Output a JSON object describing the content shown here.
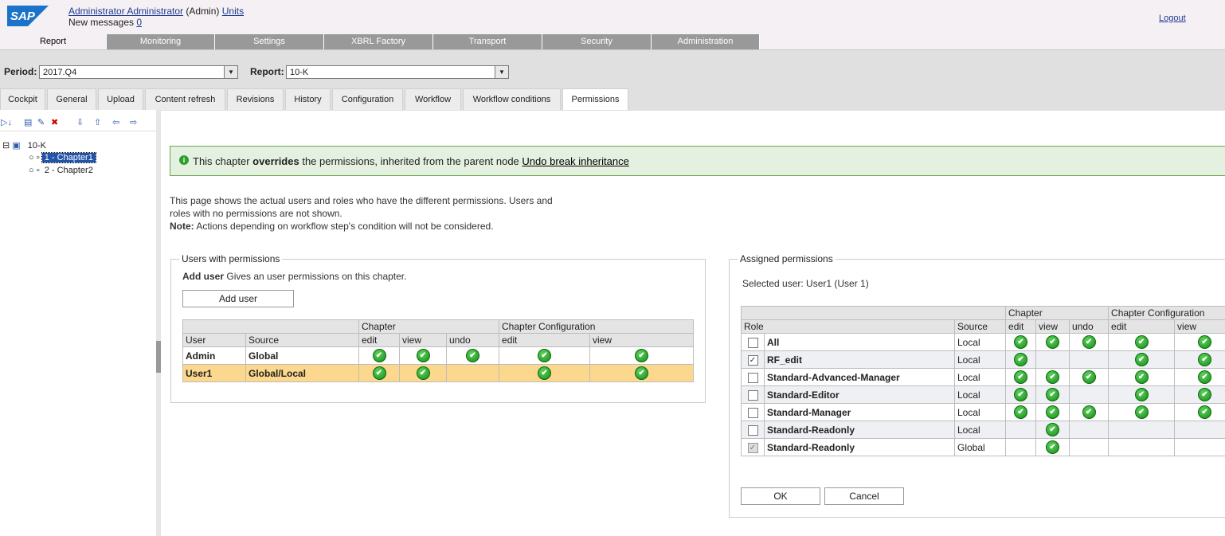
{
  "header": {
    "logo_text": "SAP",
    "user_name": "Administrator Administrator",
    "user_role": "(Admin)",
    "units_link": "Units",
    "new_messages_label": "New messages",
    "new_messages_count": "0",
    "logout": "Logout"
  },
  "main_nav": [
    "Report",
    "Monitoring",
    "Settings",
    "XBRL Factory",
    "Transport",
    "Security",
    "Administration"
  ],
  "filters": {
    "period_label": "Period:",
    "period_value": "2017.Q4",
    "report_label": "Report:",
    "report_value": "10-K"
  },
  "sub_tabs": [
    "Cockpit",
    "General",
    "Upload",
    "Content refresh",
    "Revisions",
    "History",
    "Configuration",
    "Workflow",
    "Workflow conditions",
    "Permissions"
  ],
  "tree": {
    "root": "10-K",
    "children": [
      "1 - Chapter1",
      "2 - Chapter2"
    ]
  },
  "info": {
    "pre": "This chapter",
    "bold": "overrides",
    "post": "the permissions, inherited from the parent node",
    "link": "Undo break inheritance"
  },
  "description": {
    "line1": "This page shows the actual users and roles who have the different permissions. Users and",
    "line2": "roles with no permissions are not shown.",
    "note_label": "Note:",
    "note_text": "Actions depending on workflow step's condition will not be considered."
  },
  "users_panel": {
    "legend": "Users with permissions",
    "add_user_bold": "Add user",
    "add_user_desc": "Gives an user permissions on this chapter.",
    "add_user_button": "Add user",
    "group_chapter": "Chapter",
    "group_chapter_config": "Chapter Configuration",
    "columns": [
      "User",
      "Source",
      "edit",
      "view",
      "undo",
      "edit",
      "view"
    ],
    "rows": [
      {
        "user": "Admin",
        "source": "Global",
        "perms": [
          true,
          true,
          true,
          true,
          true
        ]
      },
      {
        "user": "User1",
        "source": "Global/Local",
        "perms": [
          true,
          true,
          false,
          true,
          true
        ]
      }
    ]
  },
  "assigned_panel": {
    "legend": "Assigned permissions",
    "selected_user": "Selected user: User1 (User 1)",
    "group_chapter": "Chapter",
    "group_chapter_config": "Chapter Configuration",
    "columns": [
      "Role",
      "Source",
      "edit",
      "view",
      "undo",
      "edit",
      "view"
    ],
    "rows": [
      {
        "role": "All",
        "source": "Local",
        "checked": false,
        "disabled": false,
        "perms": [
          true,
          true,
          true,
          true,
          true
        ]
      },
      {
        "role": "RF_edit",
        "source": "Local",
        "checked": true,
        "disabled": false,
        "perms": [
          true,
          false,
          false,
          true,
          true
        ]
      },
      {
        "role": "Standard-Advanced-Manager",
        "source": "Local",
        "checked": false,
        "disabled": false,
        "perms": [
          true,
          true,
          true,
          true,
          true
        ]
      },
      {
        "role": "Standard-Editor",
        "source": "Local",
        "checked": false,
        "disabled": false,
        "perms": [
          true,
          true,
          false,
          true,
          true
        ]
      },
      {
        "role": "Standard-Manager",
        "source": "Local",
        "checked": false,
        "disabled": false,
        "perms": [
          true,
          true,
          true,
          true,
          true
        ]
      },
      {
        "role": "Standard-Readonly",
        "source": "Local",
        "checked": false,
        "disabled": false,
        "perms": [
          false,
          true,
          false,
          false,
          false
        ]
      },
      {
        "role": "Standard-Readonly",
        "source": "Global",
        "checked": true,
        "disabled": true,
        "perms": [
          false,
          true,
          false,
          false,
          false
        ]
      }
    ],
    "ok_button": "OK",
    "cancel_button": "Cancel"
  }
}
